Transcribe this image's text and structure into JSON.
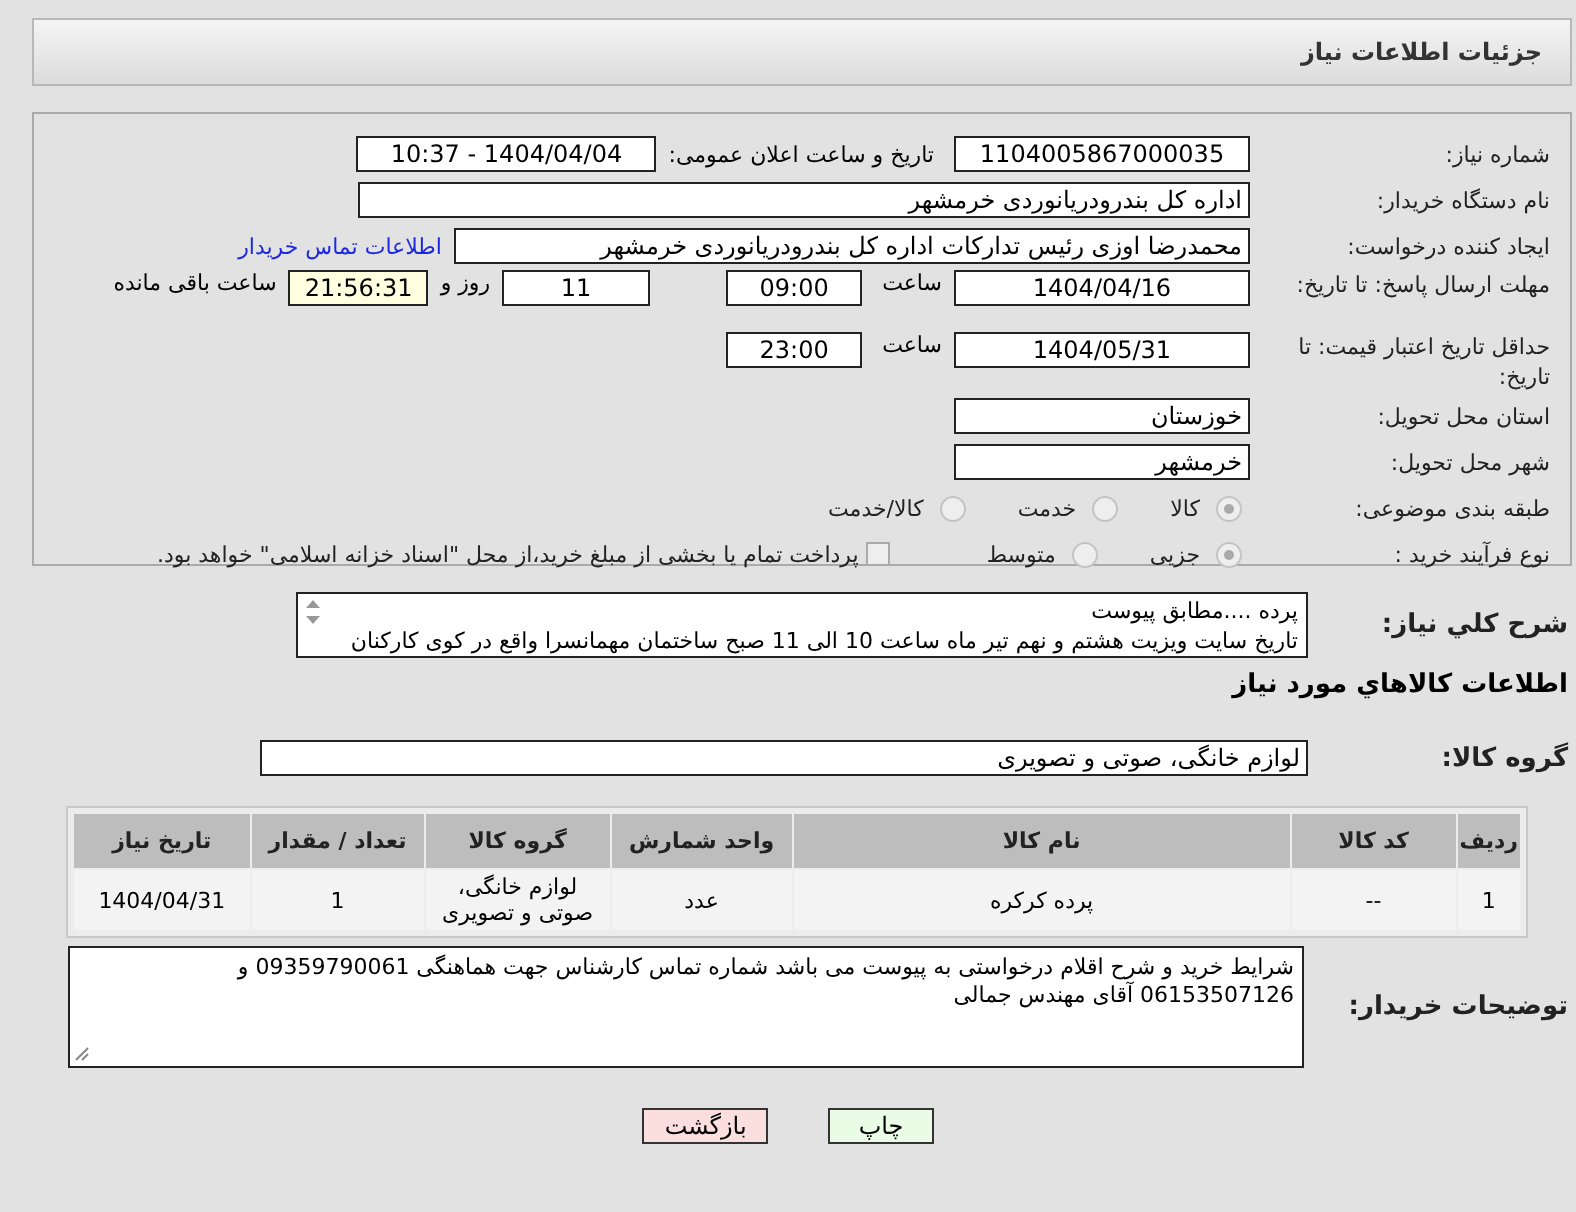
{
  "header": {
    "title": "جزئیات اطلاعات نیاز"
  },
  "need_number": {
    "label": "شماره نیاز:",
    "value": "1104005867000035"
  },
  "announce": {
    "label": "تاریخ و ساعت اعلان عمومی:",
    "value": "1404/04/04 - 10:37"
  },
  "buyer_org": {
    "label": "نام دستگاه خریدار:",
    "value": "اداره کل بندرودریانوردی خرمشهر"
  },
  "requester": {
    "label": "ایجاد کننده درخواست:",
    "value": "محمدرضا اوزی رئیس تدارکات اداره کل بندرودریانوردی خرمشهر",
    "link": "اطلاعات تماس خریدار"
  },
  "deadline": {
    "label": "مهلت ارسال پاسخ: تا تاریخ:",
    "date": "1404/04/16",
    "time_label": "ساعت",
    "time": "09:00",
    "days": "11",
    "days_label": "روز و",
    "remaining": "21:56:31",
    "remaining_label": "ساعت باقی مانده"
  },
  "validity": {
    "label": "حداقل تاریخ اعتبار قیمت: تا تاریخ:",
    "date": "1404/05/31",
    "time_label": "ساعت",
    "time": "23:00"
  },
  "province": {
    "label": "استان محل تحویل:",
    "value": "خوزستان"
  },
  "city": {
    "label": "شهر محل تحویل:",
    "value": "خرمشهر"
  },
  "category": {
    "label": "طبقه بندی موضوعی:",
    "options": [
      {
        "label": "کالا",
        "selected": true
      },
      {
        "label": "خدمت",
        "selected": false
      },
      {
        "label": "کالا/خدمت",
        "selected": false
      }
    ]
  },
  "process": {
    "label": "نوع فرآیند خرید :",
    "options": [
      {
        "label": "جزیی",
        "selected": true
      },
      {
        "label": "متوسط",
        "selected": false
      }
    ],
    "payment": {
      "label": "پرداخت تمام یا بخشی از مبلغ خرید،از محل \"اسناد خزانه اسلامی\" خواهد بود.",
      "checked": false
    }
  },
  "description": {
    "label": "شرح کلي نياز:",
    "lines": [
      "پرده ....مطابق پیوست",
      "تاریخ سایت ویزیت هشتم و نهم تیر ماه ساعت 10 الی 11 صبح ساختمان مهمانسرا واقع در کوی کارکنان"
    ]
  },
  "goods_title": "اطلاعات کالاهاي مورد نياز",
  "goods_group": {
    "label": "گروه کالا:",
    "value": "لوازم خانگی، صوتی و تصویری"
  },
  "table": {
    "columns": [
      "ردیف",
      "کد کالا",
      "نام کالا",
      "واحد شمارش",
      "گروه کالا",
      "تعداد / مقدار",
      "تاریخ نیاز"
    ],
    "rows": [
      [
        "1",
        "--",
        "پرده کرکره",
        "عدد",
        "لوازم خانگی، صوتی و تصویری",
        "1",
        "1404/04/31"
      ]
    ]
  },
  "notes": {
    "label": "توضیحات خریدار:",
    "value": "شرایط خرید و شرح اقلام درخواستی به پیوست می باشد شماره تماس کارشناس جهت هماهنگی 09359790061 و 06153507126 آقای مهندس جمالی"
  },
  "buttons": [
    {
      "label": "چاپ",
      "kind": "print"
    },
    {
      "label": "بازگشت",
      "kind": "back"
    }
  ]
}
